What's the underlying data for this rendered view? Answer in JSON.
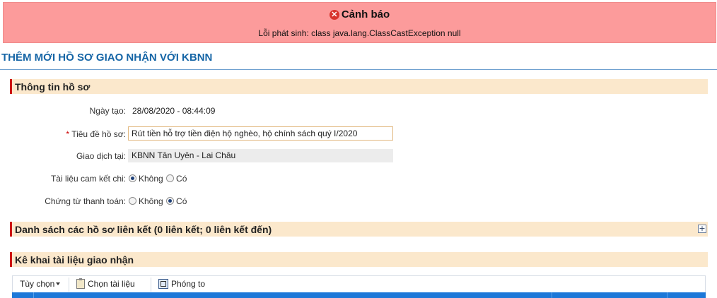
{
  "alert": {
    "title": "Cảnh báo",
    "message": "Lỗi phát sinh: class java.lang.ClassCastException null",
    "icon": "error-circle-icon",
    "background": "#fc9b9b"
  },
  "page": {
    "title": "THÊM MỚI HỒ SƠ GIAO NHẬN VỚI KBNN",
    "title_color": "#1565a6"
  },
  "sections": {
    "record_info": "Thông tin hồ sơ",
    "linked_records": "Danh sách các hồ sơ liên kết (0 liên kết; 0 liên kết đến)",
    "declare_docs": "Kê khai tài liệu giao nhận",
    "accent_color": "#cc1414"
  },
  "form": {
    "created_date": {
      "label": "Ngày tạo:",
      "value": "28/08/2020 - 08:44:09"
    },
    "record_title": {
      "required_mark": "*",
      "label": "Tiêu đề hồ sơ:",
      "value": "Rút tiền hỗ trợ tiền điện hộ nghèo, hộ chính sách quý I/2020"
    },
    "transaction_at": {
      "label": "Giao dịch tại:",
      "value": "KBNN Tân Uyên - Lai Châu"
    },
    "commitment_doc": {
      "label": "Tài liệu cam kết chi:",
      "options": [
        "Không",
        "Có"
      ],
      "selected": "Không"
    },
    "payment_voucher": {
      "label": "Chứng từ thanh toán:",
      "options": [
        "Không",
        "Có"
      ],
      "selected": "Có"
    }
  },
  "toolbar": {
    "options_label": "Tùy chọn",
    "choose_doc_label": "Chọn tài liệu",
    "zoom_label": "Phóng to"
  },
  "icons": {
    "expand": "plus-square-icon",
    "choose_doc": "document-icon",
    "zoom": "zoom-icon"
  }
}
